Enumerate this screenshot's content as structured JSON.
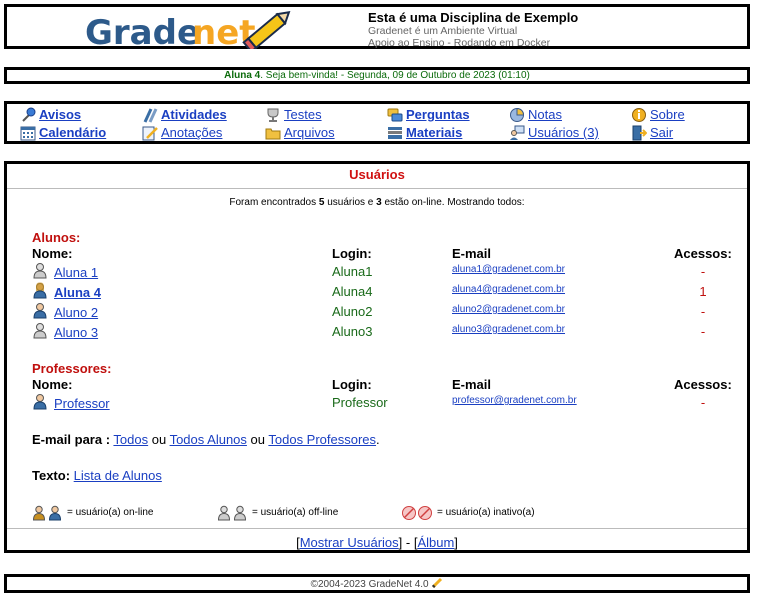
{
  "header": {
    "logo_text_1": "Grade",
    "logo_text_2": "net",
    "course_title": "Esta é uma Disciplina de Exemplo",
    "subtitle_1": "Gradenet é um Ambiente Virtual",
    "subtitle_2": "Apoio ao Ensino - Rodando em Docker"
  },
  "welcome": {
    "user": "Aluna 4",
    "text": ". Seja bem-vinda! - Segunda, 09 de Outubro de 2023 (01:10)"
  },
  "menu": {
    "avisos": "Avisos",
    "atividades": "Atividades",
    "testes": "Testes",
    "perguntas": "Perguntas",
    "notas": "Notas",
    "sobre": "Sobre",
    "calendario": "Calendário",
    "anotacoes": "Anotações",
    "arquivos": "Arquivos",
    "materiais": "Materiais",
    "usuarios": "Usuários (3)",
    "sair": "Sair"
  },
  "main": {
    "title": "Usuários",
    "summary_prefix": "Foram encontrados ",
    "summary_total": "5",
    "summary_mid": " usuários e ",
    "summary_online": "3",
    "summary_suffix": " estão on-line. Mostrando todos:",
    "alunos_heading": "Alunos:",
    "professores_heading": "Professores:",
    "col_nome": "Nome:",
    "col_login": "Login:",
    "col_email": "E-mail",
    "col_acessos": "Acessos:",
    "alunos": [
      {
        "name": "Aluna 1",
        "login": "Aluna1",
        "email": "aluna1@gradenet.com.br",
        "acessos": "-"
      },
      {
        "name": "Aluna 4",
        "login": "Aluna4",
        "email": "aluna4@gradenet.com.br",
        "acessos": "1"
      },
      {
        "name": "Aluno 2",
        "login": "Aluno2",
        "email": "aluno2@gradenet.com.br",
        "acessos": "-"
      },
      {
        "name": "Aluno 3",
        "login": "Aluno3",
        "email": "aluno3@gradenet.com.br",
        "acessos": "-"
      }
    ],
    "professores": [
      {
        "name": "Professor",
        "login": "Professor",
        "email": "professor@gradenet.com.br",
        "acessos": "-"
      }
    ],
    "email_label": "E-mail para :",
    "email_todos": "Todos",
    "email_ou_1": " ou ",
    "email_alunos": "Todos Alunos",
    "email_ou_2": " ou ",
    "email_professores": "Todos Professores",
    "email_dot": ".",
    "texto_label": "Texto:",
    "texto_link": "Lista de Alunos",
    "legend_online": "= usuário(a) on-line",
    "legend_offline": "= usuário(a) off-line",
    "legend_inactive": "= usuário(a) inativo(a)",
    "bottom_open_1": "[",
    "mostrar_usuarios": "Mostrar Usuários",
    "bottom_sep": "] - [",
    "album": "Álbum",
    "bottom_close": "]"
  },
  "footer": {
    "text": "©2004-2023 GradeNet 4.0"
  },
  "colors": {
    "link": "#1a3fc2",
    "heading_red": "#c0100e",
    "login_green": "#1a6a1a",
    "logo_blue": "#2d5a8a",
    "logo_orange": "#f5a623"
  },
  "icons": {
    "online": "user-online-icon",
    "offline": "user-offline-icon",
    "inactive": "user-inactive-icon"
  }
}
